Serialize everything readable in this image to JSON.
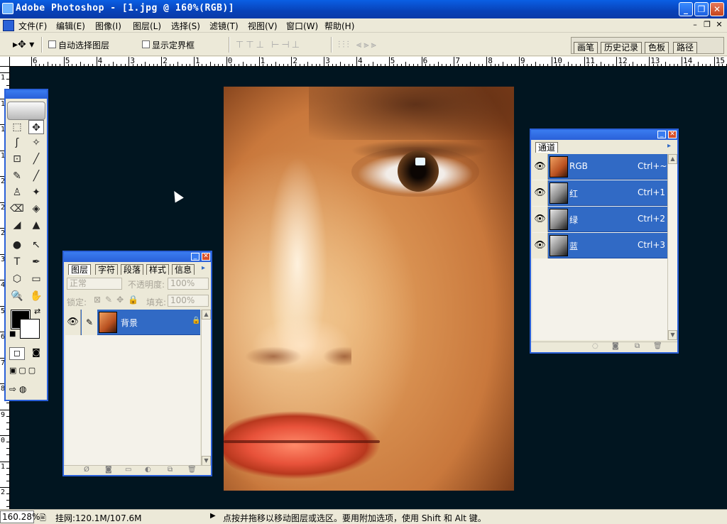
{
  "window": {
    "title": "Adobe Photoshop - [1.jpg @ 160%(RGB)]",
    "min": "_",
    "max": "❐",
    "close": "✕"
  },
  "menu": [
    "文件(F)",
    "编辑(E)",
    "图像(I)",
    "图层(L)",
    "选择(S)",
    "滤镜(T)",
    "视图(V)",
    "窗口(W)",
    "帮助(H)"
  ],
  "mdi_controls": [
    "–",
    "❐",
    "✕"
  ],
  "options": {
    "move_tool": "▸✥ ▾",
    "auto_select_layer": "自动选择图层",
    "show_bounding_box": "显示定界框",
    "align_group_1": "⊤⊤⊥ ⊢⊣⊥",
    "align_group_2": "⫶⫶⫶ ⫷⫸⫸"
  },
  "palette_well_tabs": [
    "画笔",
    "历史记录",
    "色板",
    "路径"
  ],
  "ruler": {
    "top_labels": [
      "6",
      "5",
      "4",
      "3",
      "2",
      "1",
      "0",
      "1",
      "2",
      "3",
      "4",
      "5",
      "6",
      "7",
      "8",
      "9",
      "10",
      "11",
      "12",
      "13",
      "14",
      "15"
    ],
    "left_labels": [
      "1",
      "1",
      "1",
      "1",
      "2",
      "2",
      "2",
      "3",
      "4",
      "5",
      "6",
      "7",
      "8",
      "9",
      "0",
      "1",
      "2"
    ]
  },
  "toolbox": {
    "tools": [
      "⬚",
      "✥",
      "ʃ",
      "✧",
      "⊡",
      "╱",
      "✎",
      "╱",
      "♙",
      "✦",
      "⌫",
      "◈",
      "◢",
      "▲",
      "●",
      "↖",
      "T",
      "✒",
      "⬡",
      "▭",
      "✍",
      "✋",
      "🔍"
    ],
    "fg_color": "#000000",
    "bg_color": "#ffffff"
  },
  "layers_panel": {
    "tabs": [
      "图层",
      "字符",
      "段落",
      "样式",
      "信息"
    ],
    "blend_mode": "正常",
    "opacity_label": "不透明度:",
    "opacity_value": "100%",
    "lock_label": "锁定:",
    "fill_label": "填充:",
    "fill_value": "100%",
    "layers": [
      {
        "name": "背景",
        "visible": true,
        "locked": true
      }
    ]
  },
  "channels_panel": {
    "tab": "通道",
    "channels": [
      {
        "name": "RGB",
        "shortcut": "Ctrl+~",
        "thumb": "color"
      },
      {
        "name": "红",
        "shortcut": "Ctrl+1",
        "thumb": "gray"
      },
      {
        "name": "绿",
        "shortcut": "Ctrl+2",
        "thumb": "gray"
      },
      {
        "name": "蓝",
        "shortcut": "Ctrl+3",
        "thumb": "gray"
      }
    ]
  },
  "status": {
    "zoom": "160.28%",
    "doc_size": "挂网:120.1M/107.6M",
    "hint": "点按并拖移以移动图层或选区。要用附加选项，使用 Shift 和 Alt 键。"
  },
  "colors": {
    "title_blue": "#0a5fe4",
    "selection_blue": "#316ac5",
    "workspace": "#011520",
    "chrome": "#ece9d8"
  }
}
